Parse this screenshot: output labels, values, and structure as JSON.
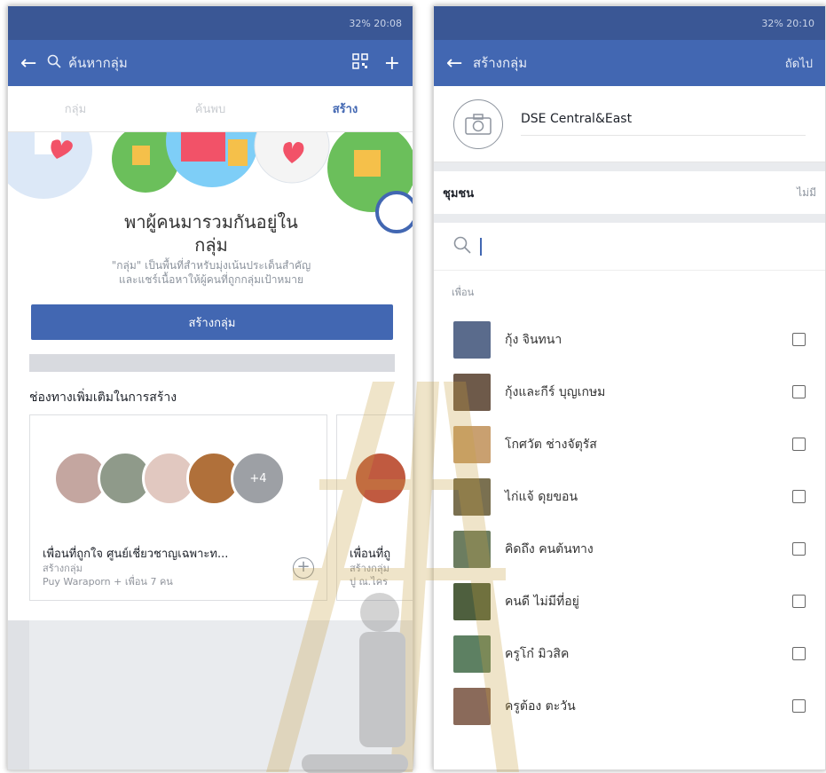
{
  "left": {
    "status_text": "\u0011 \u001b\u0016 32% \u0016 20:08",
    "search_placeholder": "ค้นหากลุ่ม",
    "tabs": [
      "กลุ่ม",
      "ค้นพบ",
      "สร้าง"
    ],
    "hero_title_line1": "พาผู้คนมารวมกันอยู่ใน",
    "hero_title_line2": "กลุ่ม",
    "hero_desc_line1": "\"กลุ่ม\" เป็นพื้นที่สำหรับมุ่งเน้นประเด็นสำคัญ",
    "hero_desc_line2": "และแชร์เนื้อหาให้ผู้คนที่ถูกกลุ่มเป้าหมาย",
    "create_button": "สร้างกลุ่ม",
    "more_ways_title": "ช่องทางเพิ่มเติมในการสร้าง",
    "card": {
      "more_count": "+4",
      "name": "เพื่อนที่ถูกใจ ศูนย์เชี่ยวชาญเฉพาะท...",
      "sub1": "สร้างกลุ่ม",
      "sub2": "Puy Waraporn + เพื่อน 7 คน"
    },
    "card2": {
      "name": "เพื่อนที่ถู",
      "sub1": "สร้างกลุ่ม",
      "sub2": "ปู ณ.ไคร"
    }
  },
  "right": {
    "status_text": "32% 20:10",
    "title": "สร้างกลุ่ม",
    "next": "ถัดไป",
    "group_name": "DSE Central&East",
    "privacy_label": "ชุมชน",
    "privacy_value": "ไม่มี",
    "friends_header": "เพื่อน",
    "friends": [
      {
        "name": "กุ้ง จินทนา",
        "color": "#5a6b8c"
      },
      {
        "name": "กุ้งและกีร์ บุญเกษม",
        "color": "#6e5a4a"
      },
      {
        "name": "โกศวัต ช่างจัตุรัส",
        "color": "#c9a070"
      },
      {
        "name": "ไก่แจ้ ดุยขอน",
        "color": "#7a7050"
      },
      {
        "name": "คิดถึง คนต้นทาง",
        "color": "#6c7d60"
      },
      {
        "name": "คนดี ไม่มีที่อยู่",
        "color": "#4e5f3e"
      },
      {
        "name": "ครูโก๋ มิวสิค",
        "color": "#5d8062"
      },
      {
        "name": "ครูต้อง ตะวัน",
        "color": "#8a6a5a"
      }
    ]
  },
  "colors": {
    "fb_blue": "#4267b2",
    "fb_dark": "#3a5795"
  }
}
